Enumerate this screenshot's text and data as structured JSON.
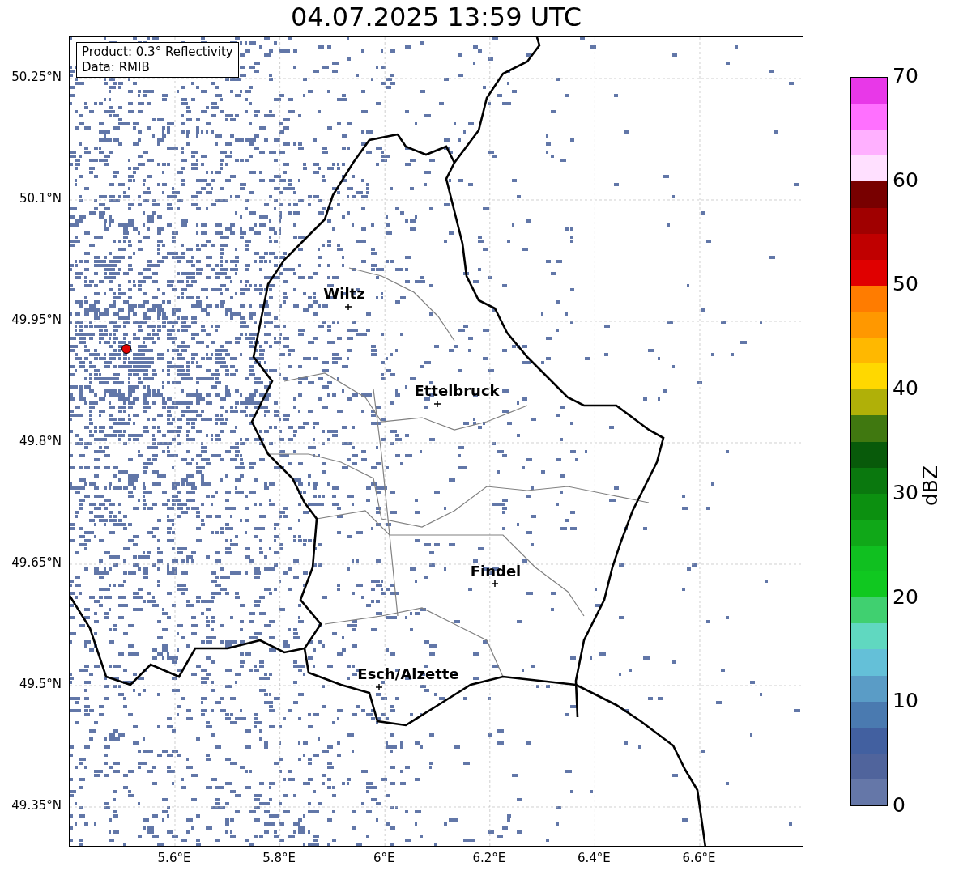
{
  "title": "04.07.2025 13:59 UTC",
  "info_box": [
    "Product: 0.3° Reflectivity",
    "Data: RMIB"
  ],
  "map": {
    "lat_labels": [
      "50.25°N",
      "50.1°N",
      "49.95°N",
      "49.8°N",
      "49.65°N",
      "49.5°N",
      "49.35°N"
    ],
    "lon_labels": [
      "5.6°E",
      "5.8°E",
      "6°E",
      "6.2°E",
      "6.4°E",
      "6.6°E"
    ]
  },
  "cities": [
    {
      "name": "Wiltz"
    },
    {
      "name": "Ettelbruck"
    },
    {
      "name": "Findel"
    },
    {
      "name": "Esch/Alzette"
    }
  ],
  "colorbar": {
    "label": "dBZ",
    "ticks": [
      "70",
      "60",
      "50",
      "40",
      "30",
      "20",
      "10",
      "0"
    ],
    "bins": [
      {
        "color": "#e838e8"
      },
      {
        "color": "#ff70ff"
      },
      {
        "color": "#ffb0ff"
      },
      {
        "color": "#ffe0ff"
      },
      {
        "color": "#780000"
      },
      {
        "color": "#a00000"
      },
      {
        "color": "#c00000"
      },
      {
        "color": "#e00000"
      },
      {
        "color": "#ff7c00"
      },
      {
        "color": "#ff9800"
      },
      {
        "color": "#ffb800"
      },
      {
        "color": "#ffd800"
      },
      {
        "color": "#b0b008"
      },
      {
        "color": "#407810"
      },
      {
        "color": "#085a0a"
      },
      {
        "color": "#0a780e"
      },
      {
        "color": "#0c9010"
      },
      {
        "color": "#10a818"
      },
      {
        "color": "#10c020"
      },
      {
        "color": "#10c820"
      },
      {
        "color": "#40d070"
      },
      {
        "color": "#60d8c0"
      },
      {
        "color": "#64c0d8"
      },
      {
        "color": "#5a9cc6"
      },
      {
        "color": "#4a7ab0"
      },
      {
        "color": "#4260a0"
      },
      {
        "color": "#50649c"
      },
      {
        "color": "#6577a8"
      }
    ]
  }
}
